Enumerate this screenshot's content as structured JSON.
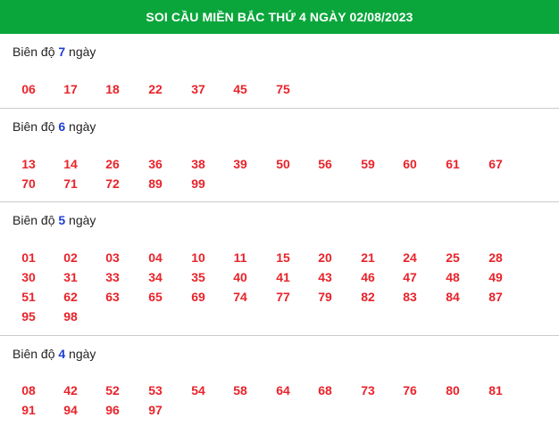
{
  "header": {
    "title": "SOI CẦU MIỀN BẮC THỨ 4 NGÀY 02/08/2023"
  },
  "label_prefix": "Biên độ",
  "label_suffix": "ngày",
  "sections": [
    {
      "span": "7",
      "numbers": [
        "06",
        "17",
        "18",
        "22",
        "37",
        "45",
        "75"
      ]
    },
    {
      "span": "6",
      "numbers": [
        "13",
        "14",
        "26",
        "36",
        "38",
        "39",
        "50",
        "56",
        "59",
        "60",
        "61",
        "67",
        "70",
        "71",
        "72",
        "89",
        "99"
      ]
    },
    {
      "span": "5",
      "numbers": [
        "01",
        "02",
        "03",
        "04",
        "10",
        "11",
        "15",
        "20",
        "21",
        "24",
        "25",
        "28",
        "30",
        "31",
        "33",
        "34",
        "35",
        "40",
        "41",
        "43",
        "46",
        "47",
        "48",
        "49",
        "51",
        "62",
        "63",
        "65",
        "69",
        "74",
        "77",
        "79",
        "82",
        "83",
        "84",
        "87",
        "95",
        "98"
      ]
    },
    {
      "span": "4",
      "numbers": [
        "08",
        "42",
        "52",
        "53",
        "54",
        "58",
        "64",
        "68",
        "73",
        "76",
        "80",
        "81",
        "91",
        "94",
        "96",
        "97"
      ]
    }
  ]
}
